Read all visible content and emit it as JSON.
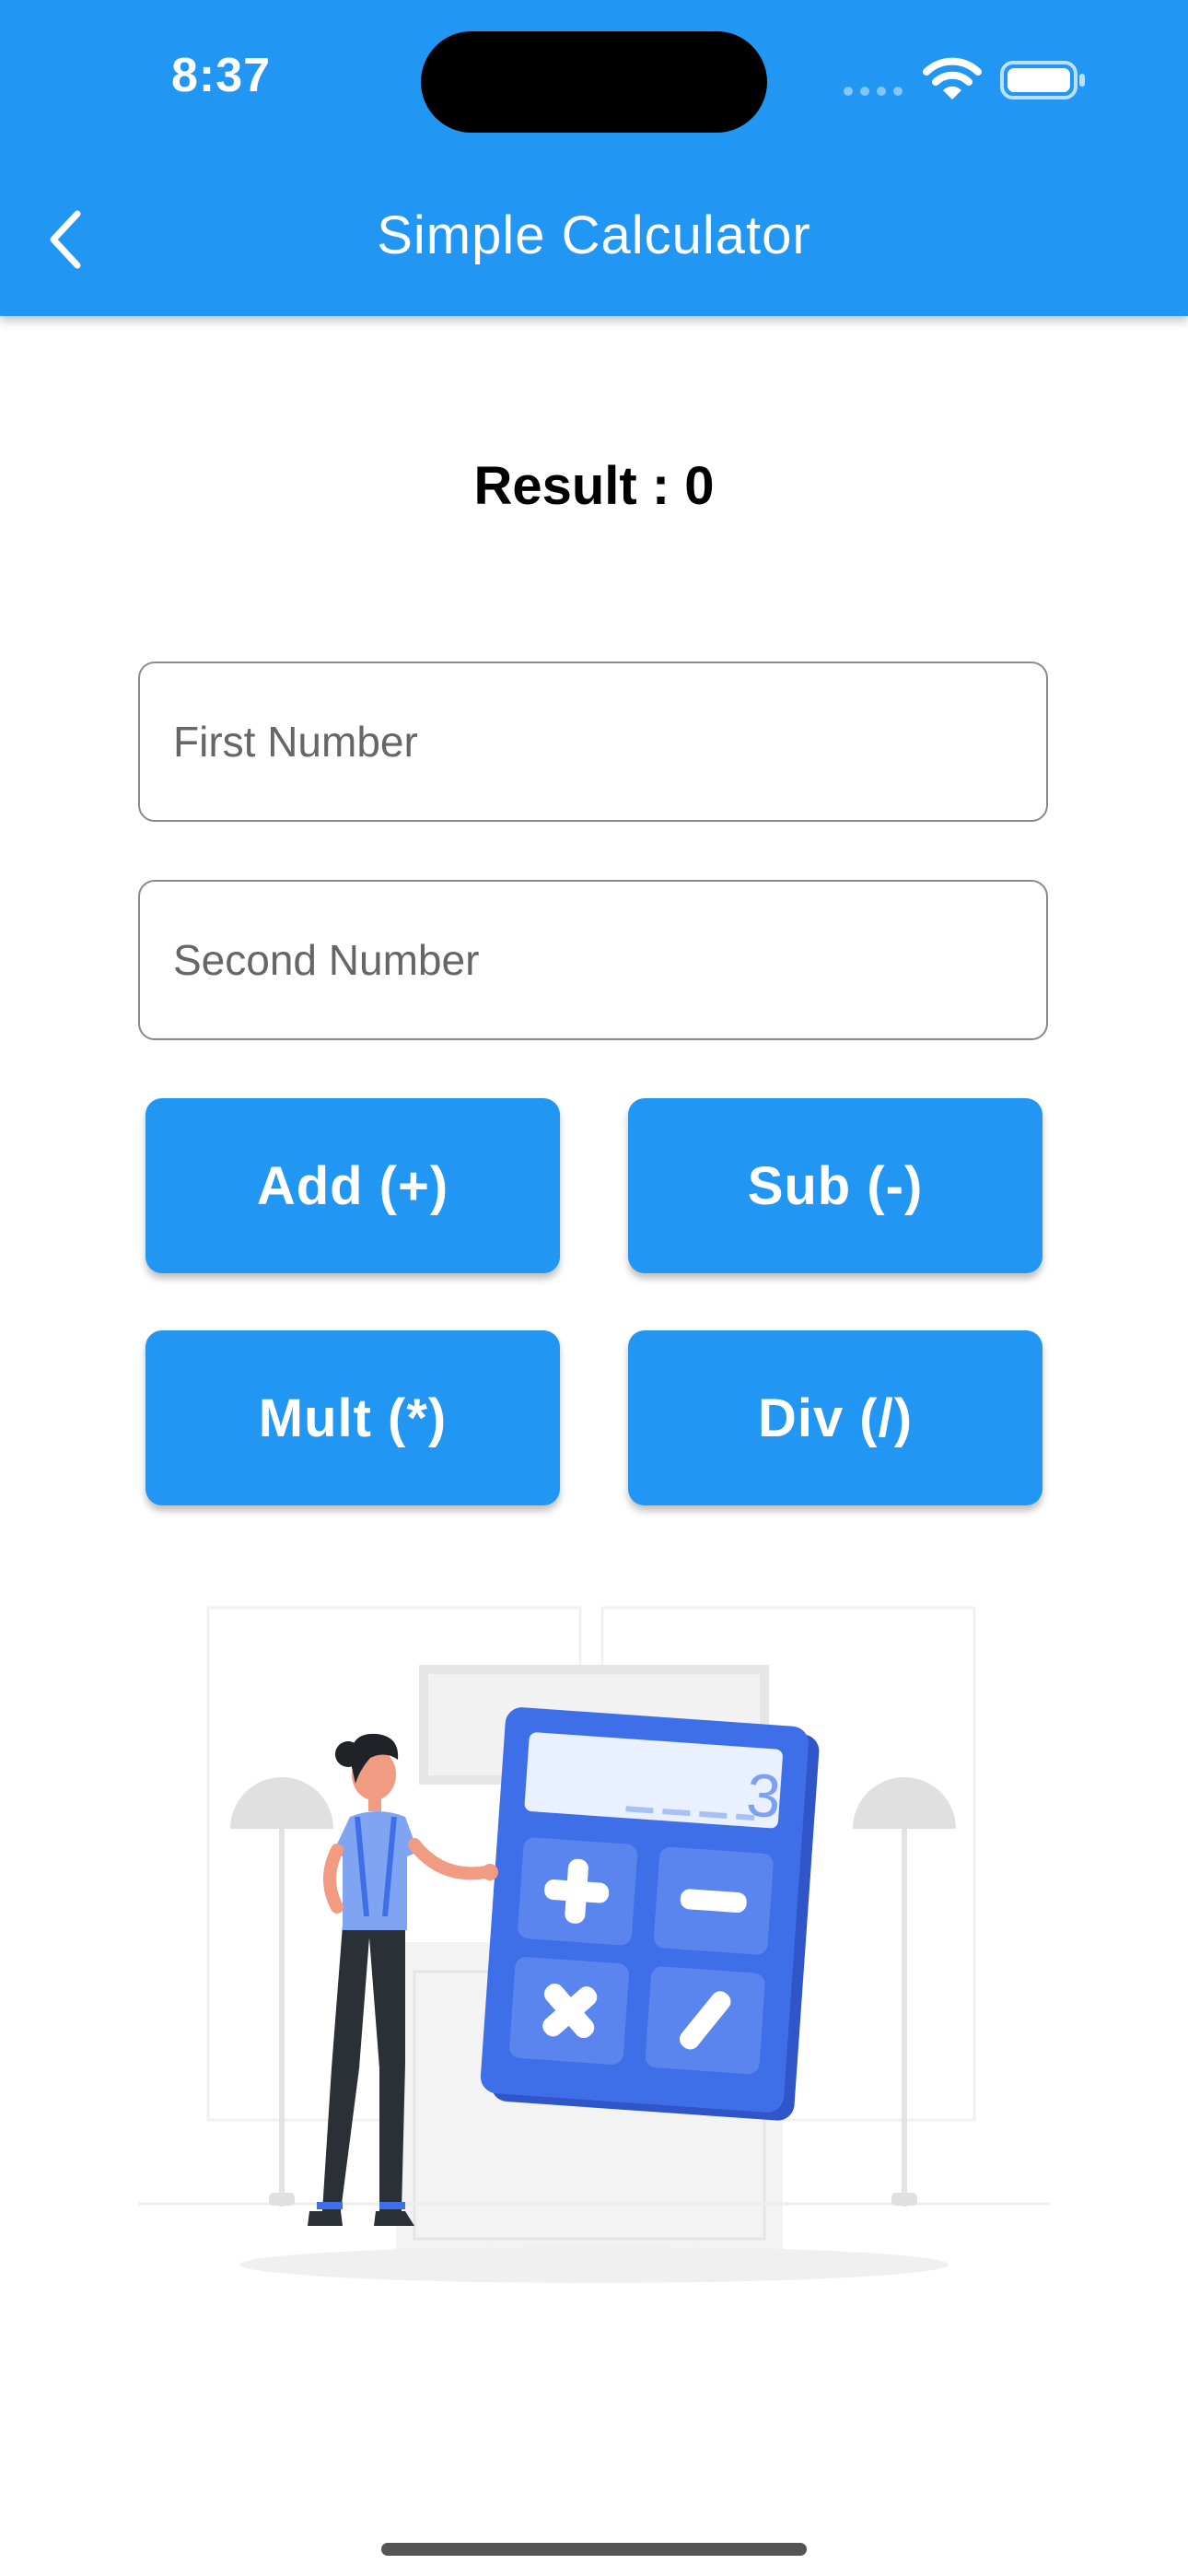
{
  "status_bar": {
    "time": "8:37"
  },
  "appbar": {
    "title": "Simple Calculator",
    "back_icon": "chevron-left-icon"
  },
  "result": {
    "text": "Result : 0"
  },
  "inputs": {
    "first_placeholder": "First Number",
    "second_placeholder": "Second Number"
  },
  "buttons": {
    "add": "Add (+)",
    "sub": "Sub (-)",
    "mult": "Mult (*)",
    "div": "Div (/)"
  },
  "illustration": {
    "display_value": "3"
  },
  "colors": {
    "primary": "#2196F3",
    "calculator_blue": "#3F6FE8"
  }
}
